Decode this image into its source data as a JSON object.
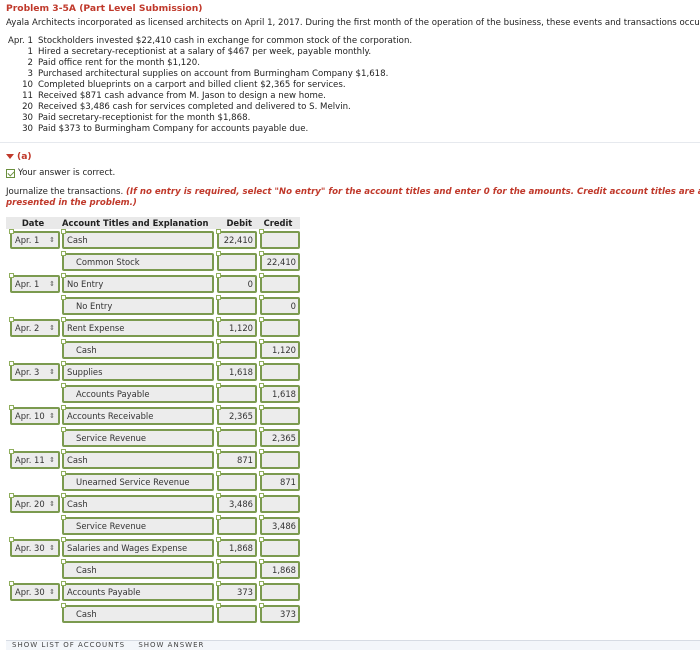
{
  "problem": {
    "title": "Problem 3-5A (Part Level Submission)",
    "intro": "Ayala Architects incorporated as licensed architects on April 1, 2017. During the first month of the operation of the business, these events and transactions occurred:",
    "transactions": [
      {
        "month": "Apr.",
        "day": "1",
        "text": "Stockholders invested $22,410 cash in exchange for common stock of the corporation."
      },
      {
        "month": "",
        "day": "1",
        "text": "Hired a secretary-receptionist at a salary of $467 per week, payable monthly."
      },
      {
        "month": "",
        "day": "2",
        "text": "Paid office rent for the month $1,120."
      },
      {
        "month": "",
        "day": "3",
        "text": "Purchased architectural supplies on account from Burmingham Company $1,618."
      },
      {
        "month": "",
        "day": "10",
        "text": "Completed blueprints on a carport and billed client $2,365 for services."
      },
      {
        "month": "",
        "day": "11",
        "text": "Received $871 cash advance from M. Jason to design a new home."
      },
      {
        "month": "",
        "day": "20",
        "text": "Received $3,486 cash for services completed and delivered to S. Melvin."
      },
      {
        "month": "",
        "day": "30",
        "text": "Paid secretary-receptionist for the month $1,868."
      },
      {
        "month": "",
        "day": "30",
        "text": "Paid $373 to Burmingham Company for accounts payable due."
      }
    ]
  },
  "part": {
    "label": "(a)",
    "status": "Your answer is correct.",
    "instruction": "Journalize the transactions.",
    "hint_line1": "(If no entry is required, select \"No entry\" for the account titles and enter 0 for the amounts. Credit account titles are autom",
    "hint_line2": "presented in the problem.)"
  },
  "journal": {
    "headers": {
      "date": "Date",
      "account": "Account Titles and Explanation",
      "debit": "Debit",
      "credit": "Credit"
    },
    "rows": [
      {
        "date": "Apr. 1",
        "account": "Cash",
        "debit": "22,410",
        "credit": "",
        "indent": false
      },
      {
        "date": "",
        "account": "Common Stock",
        "debit": "",
        "credit": "22,410",
        "indent": true
      },
      {
        "date": "Apr. 1",
        "account": "No Entry",
        "debit": "0",
        "credit": "",
        "indent": false
      },
      {
        "date": "",
        "account": "No Entry",
        "debit": "",
        "credit": "0",
        "indent": true
      },
      {
        "date": "Apr. 2",
        "account": "Rent Expense",
        "debit": "1,120",
        "credit": "",
        "indent": false
      },
      {
        "date": "",
        "account": "Cash",
        "debit": "",
        "credit": "1,120",
        "indent": true
      },
      {
        "date": "Apr. 3",
        "account": "Supplies",
        "debit": "1,618",
        "credit": "",
        "indent": false
      },
      {
        "date": "",
        "account": "Accounts Payable",
        "debit": "",
        "credit": "1,618",
        "indent": true
      },
      {
        "date": "Apr. 10",
        "account": "Accounts Receivable",
        "debit": "2,365",
        "credit": "",
        "indent": false
      },
      {
        "date": "",
        "account": "Service Revenue",
        "debit": "",
        "credit": "2,365",
        "indent": true
      },
      {
        "date": "Apr. 11",
        "account": "Cash",
        "debit": "871",
        "credit": "",
        "indent": false
      },
      {
        "date": "",
        "account": "Unearned Service Revenue",
        "debit": "",
        "credit": "871",
        "indent": true
      },
      {
        "date": "Apr. 20",
        "account": "Cash",
        "debit": "3,486",
        "credit": "",
        "indent": false
      },
      {
        "date": "",
        "account": "Service Revenue",
        "debit": "",
        "credit": "3,486",
        "indent": true
      },
      {
        "date": "Apr. 30",
        "account": "Salaries and Wages Expense",
        "debit": "1,868",
        "credit": "",
        "indent": false
      },
      {
        "date": "",
        "account": "Cash",
        "debit": "",
        "credit": "1,868",
        "indent": true
      },
      {
        "date": "Apr. 30",
        "account": "Accounts Payable",
        "debit": "373",
        "credit": "",
        "indent": false
      },
      {
        "date": "",
        "account": "Cash",
        "debit": "",
        "credit": "373",
        "indent": true
      }
    ]
  },
  "footer": {
    "show_accounts": "SHOW LIST OF ACCOUNTS",
    "show_answer": "SHOW ANSWER"
  },
  "colors": {
    "accent_red": "#c0392b",
    "field_border": "#7b9a4f",
    "field_bg": "#ececec"
  }
}
